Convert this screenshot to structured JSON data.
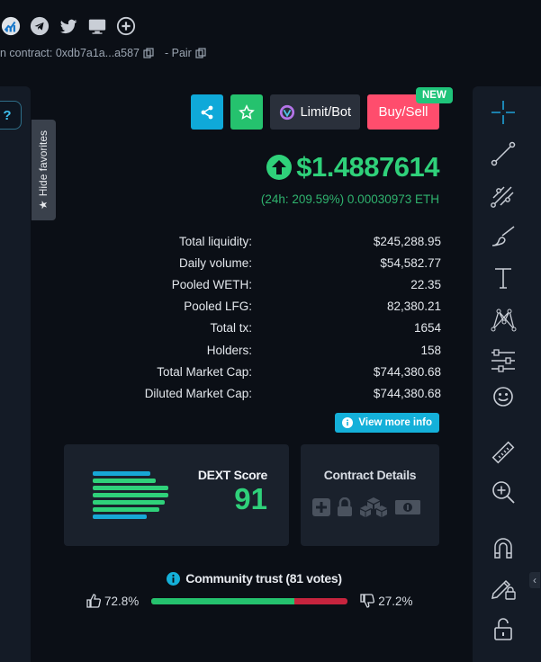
{
  "header": {
    "contract_label": "n contract: 0xdb7a1a...a587",
    "pair_label": "- Pair"
  },
  "sidebar_left": {
    "help_label": "?"
  },
  "favorites_toggle": {
    "label": "Hide favorites"
  },
  "actions": {
    "limit_label": "Limit/Bot",
    "buysell_label": "Buy/Sell",
    "new_badge": "NEW"
  },
  "price": {
    "value": "$1.4887614",
    "change_line": "(24h: 209.59%) 0.00030973 ETH",
    "direction": "up"
  },
  "stats": [
    {
      "label": "Total liquidity:",
      "value": "$245,288.95"
    },
    {
      "label": "Daily volume:",
      "value": "$54,582.77"
    },
    {
      "label": "Pooled WETH:",
      "value": "22.35"
    },
    {
      "label": "Pooled LFG:",
      "value": "82,380.21"
    },
    {
      "label": "Total tx:",
      "value": "1654"
    },
    {
      "label": "Holders:",
      "value": "158"
    },
    {
      "label": "Total Market Cap:",
      "value": "$744,380.68"
    },
    {
      "label": "Diluted Market Cap:",
      "value": "$744,380.68"
    }
  ],
  "view_more": {
    "label": "View more info"
  },
  "dext": {
    "label": "DEXT Score",
    "score": "91"
  },
  "contract_details": {
    "label": "Contract Details"
  },
  "community": {
    "title": "Community trust (81 votes)",
    "up_pct": "72.8%",
    "down_pct": "27.2%",
    "up_fraction": 0.728
  },
  "colors": {
    "accent_green": "#2fd17a",
    "accent_blue": "#0fa9d9",
    "accent_red": "#ff4d6d",
    "panel": "#141b26"
  },
  "tools": [
    "crosshair-icon",
    "trend-line-icon",
    "fib-icon",
    "brush-icon",
    "text-icon",
    "pattern-icon",
    "prediction-icon",
    "emoji-icon",
    "ruler-icon",
    "zoom-in-icon",
    "magnet-icon",
    "lock-pencil-icon",
    "unlock-icon"
  ]
}
